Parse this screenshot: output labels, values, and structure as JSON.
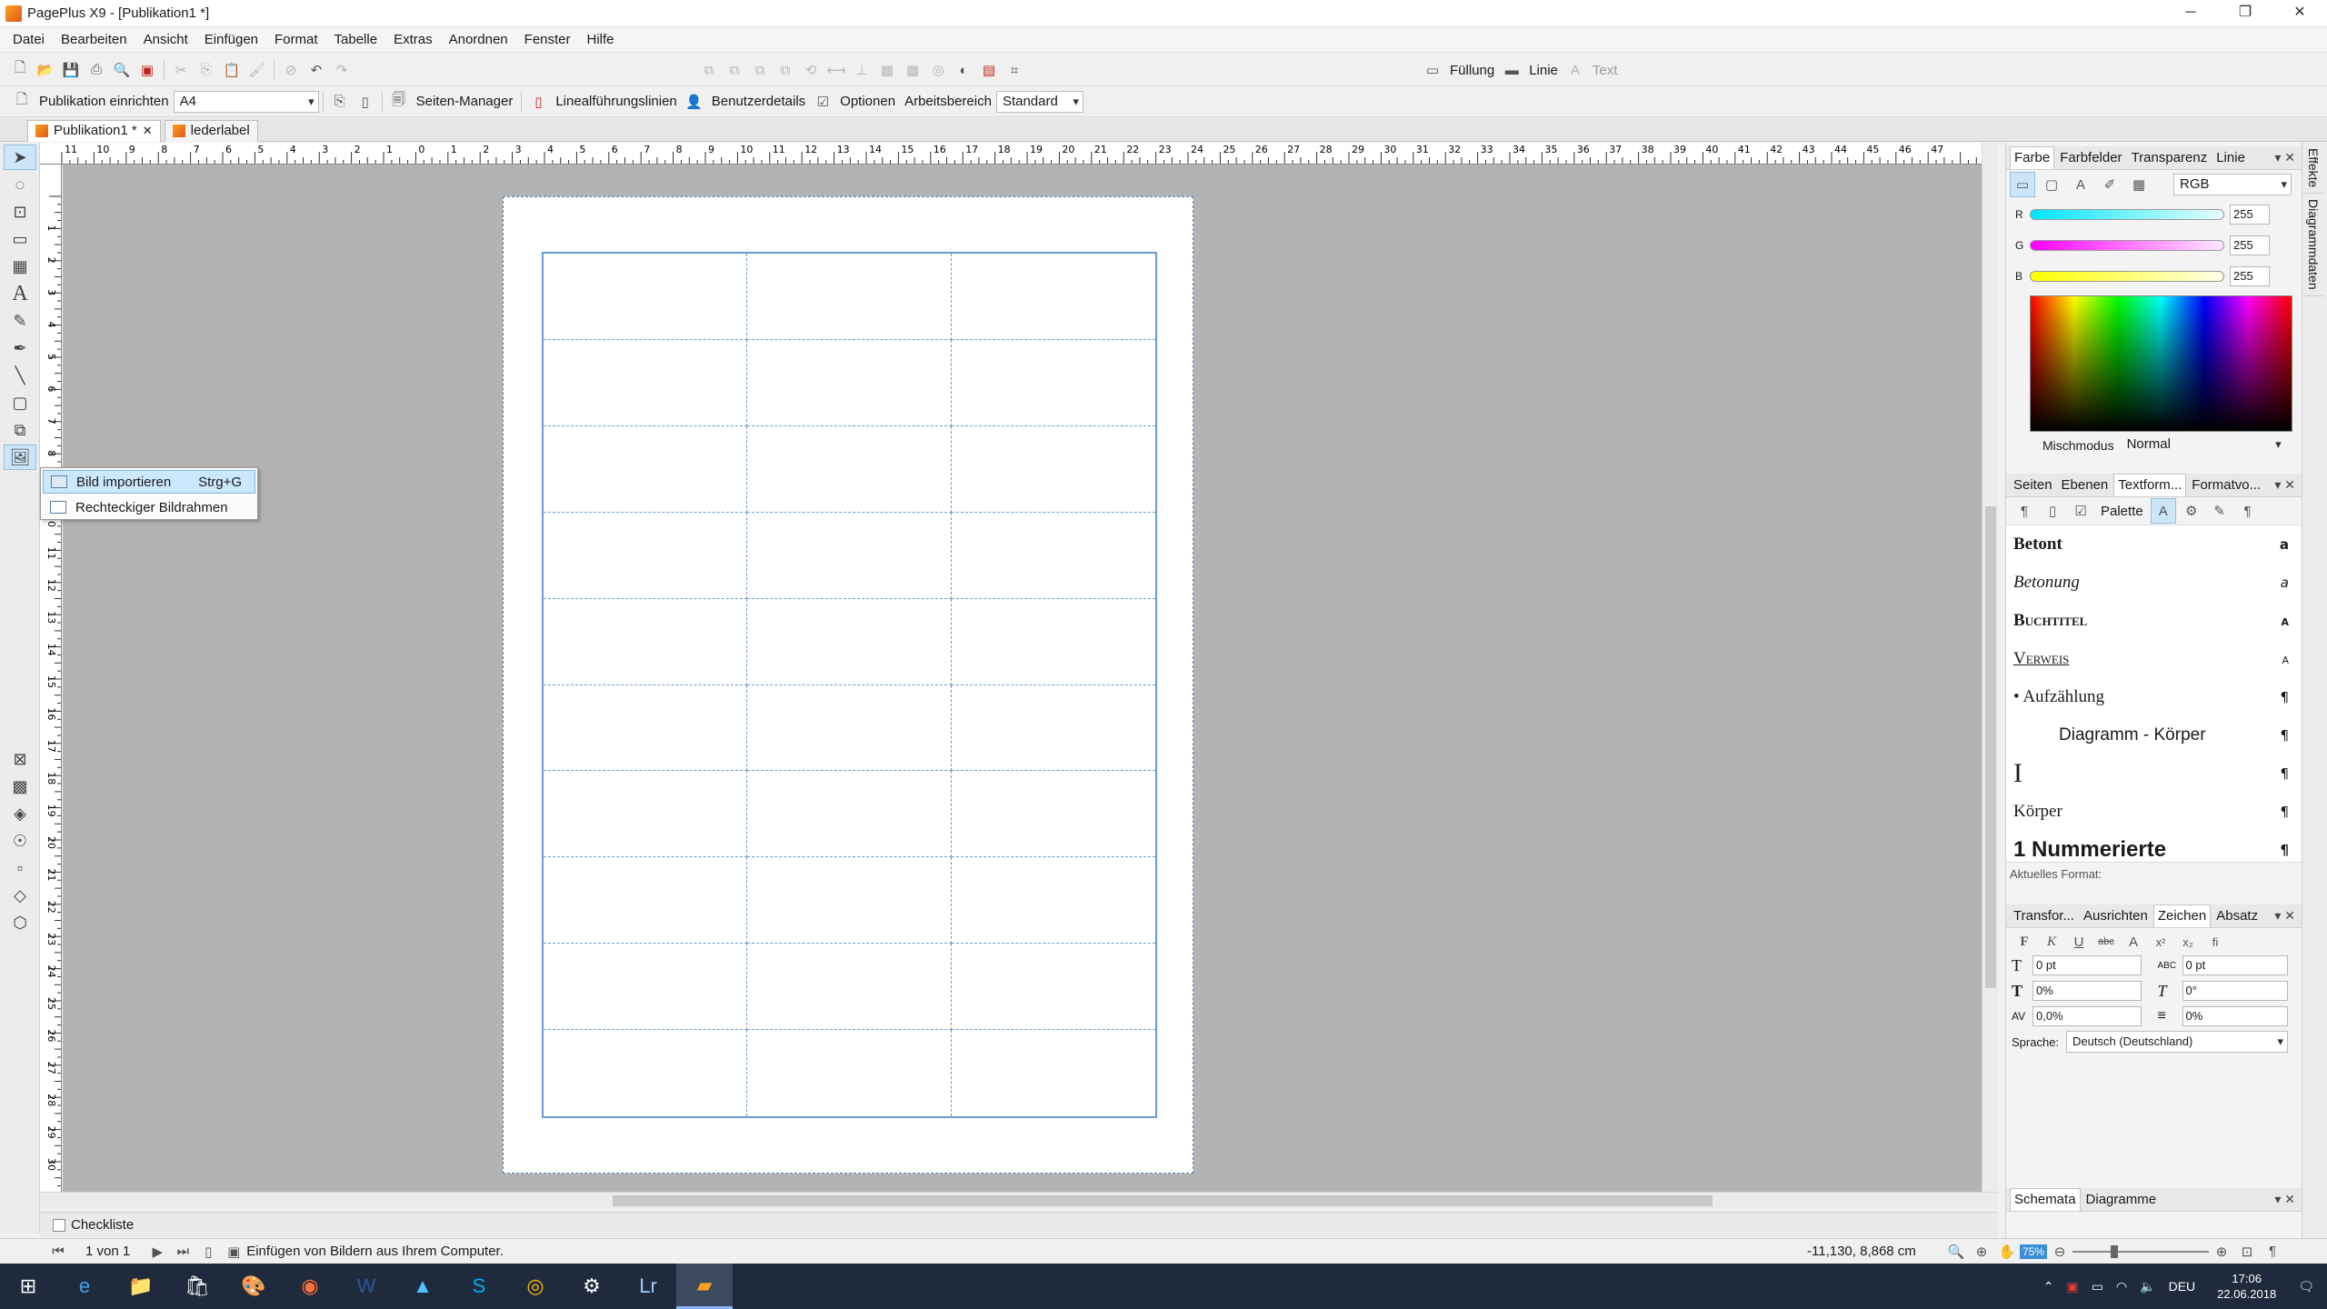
{
  "window": {
    "title": "PagePlus X9 - [Publikation1 *]",
    "minimize": "─",
    "maximize": "❐",
    "close": "✕"
  },
  "menu": [
    "Datei",
    "Bearbeiten",
    "Ansicht",
    "Einfügen",
    "Format",
    "Tabelle",
    "Extras",
    "Anordnen",
    "Fenster",
    "Hilfe"
  ],
  "toolbar_right": {
    "fill": "Füllung",
    "line": "Linie",
    "text": "Text"
  },
  "context_bar": {
    "page_setup": "Publikation einrichten",
    "page_size": "A4",
    "pages_manager": "Seiten-Manager",
    "ruler_guides": "Linealführungslinien",
    "user_details": "Benutzerdetails",
    "options": "Optionen",
    "workspace": "Arbeitsbereich",
    "workspace_value": "Standard"
  },
  "doc_tabs": [
    {
      "label": "Publikation1 *",
      "close": "✕"
    },
    {
      "label": "lederlabel"
    }
  ],
  "hruler_labels": [
    "11",
    "10",
    "9",
    "8",
    "7",
    "6",
    "5",
    "4",
    "3",
    "2",
    "1",
    "0",
    "1",
    "2",
    "3",
    "4",
    "5",
    "6",
    "7",
    "8",
    "9",
    "10",
    "11",
    "12",
    "13",
    "14",
    "15",
    "16",
    "17",
    "18",
    "19",
    "20",
    "21",
    "22",
    "23",
    "24",
    "25",
    "26",
    "27",
    "28",
    "29",
    "30",
    "31",
    "32",
    "33",
    "34",
    "35",
    "36",
    "37",
    "38",
    "39",
    "40",
    "41",
    "42",
    "43",
    "44",
    "45",
    "46",
    "47"
  ],
  "vruler_labels": [
    "1",
    "2",
    "3",
    "4",
    "5",
    "6",
    "7",
    "8",
    "9",
    "10",
    "11",
    "12",
    "13",
    "14",
    "15",
    "16",
    "17",
    "18",
    "19",
    "20",
    "21",
    "22",
    "23",
    "24",
    "25",
    "26",
    "27",
    "28",
    "29",
    "30"
  ],
  "popup": {
    "items": [
      {
        "label": "Bild importieren",
        "shortcut": "Strg+G"
      },
      {
        "label": "Rechteckiger Bildrahmen",
        "shortcut": ""
      }
    ]
  },
  "color_panel": {
    "tabs": [
      "Farbe",
      "Farbfelder",
      "Transparenz",
      "Linie"
    ],
    "model": "RGB",
    "channels": [
      {
        "name": "R",
        "value": "255",
        "color": "#00e5ff"
      },
      {
        "name": "G",
        "value": "255",
        "color": "#ff00ff"
      },
      {
        "name": "B",
        "value": "255",
        "color": "#ffff00"
      }
    ],
    "blend_label": "Mischmodus",
    "blend_value": "Normal"
  },
  "styles_panel": {
    "tabs": [
      "Seiten",
      "Ebenen",
      "Textform...",
      "Formatvo..."
    ],
    "palette": "Palette",
    "items": [
      {
        "label": "Betont",
        "mark": "a"
      },
      {
        "label": "Betonung",
        "mark": "a"
      },
      {
        "label": "Buchtitel",
        "mark": "a"
      },
      {
        "label": "Verweis",
        "mark": "a"
      },
      {
        "label": "• Aufzählung",
        "mark": "¶"
      },
      {
        "label": "Diagramm - Körper",
        "mark": "¶"
      },
      {
        "label": "I",
        "mark": "¶"
      },
      {
        "label": "Körper",
        "mark": "¶"
      },
      {
        "label": "1 Nummerierte",
        "mark": "¶"
      }
    ],
    "current_format": "Aktuelles Format:"
  },
  "char_panel": {
    "tabs": [
      "Transfor...",
      "Ausrichten",
      "Zeichen",
      "Absatz"
    ],
    "buttons": [
      "F",
      "K",
      "U",
      "abc",
      "A",
      "x²",
      "x₂",
      "fi"
    ],
    "fields": [
      {
        "icon": "T",
        "value": "0 pt"
      },
      {
        "icon": "ABC",
        "value": "0 pt"
      },
      {
        "icon": "T",
        "value": "0%"
      },
      {
        "icon": "T",
        "value": "0°"
      },
      {
        "icon": "AV",
        "value": "0,0%"
      },
      {
        "icon": "≡",
        "value": "0%"
      }
    ],
    "language_label": "Sprache:",
    "language_value": "Deutsch (Deutschland)"
  },
  "bottom_panel": {
    "tabs": [
      "Schemata",
      "Diagramme"
    ]
  },
  "side_tabs": [
    "Effekte",
    "Diagrammdaten"
  ],
  "checklist": "Checkliste",
  "status": {
    "page": "1 von 1",
    "message": "Einfügen von Bildern aus Ihrem Computer.",
    "coords": "-11,130, 8,868 cm",
    "zoom": "75%"
  },
  "taskbar": {
    "lang": "DEU",
    "time": "17:06",
    "date": "22.06.2018"
  },
  "colors": {
    "accent": "#0078d7",
    "page_guides": "#6a9bd4",
    "canvas": "#b3b3b3"
  }
}
